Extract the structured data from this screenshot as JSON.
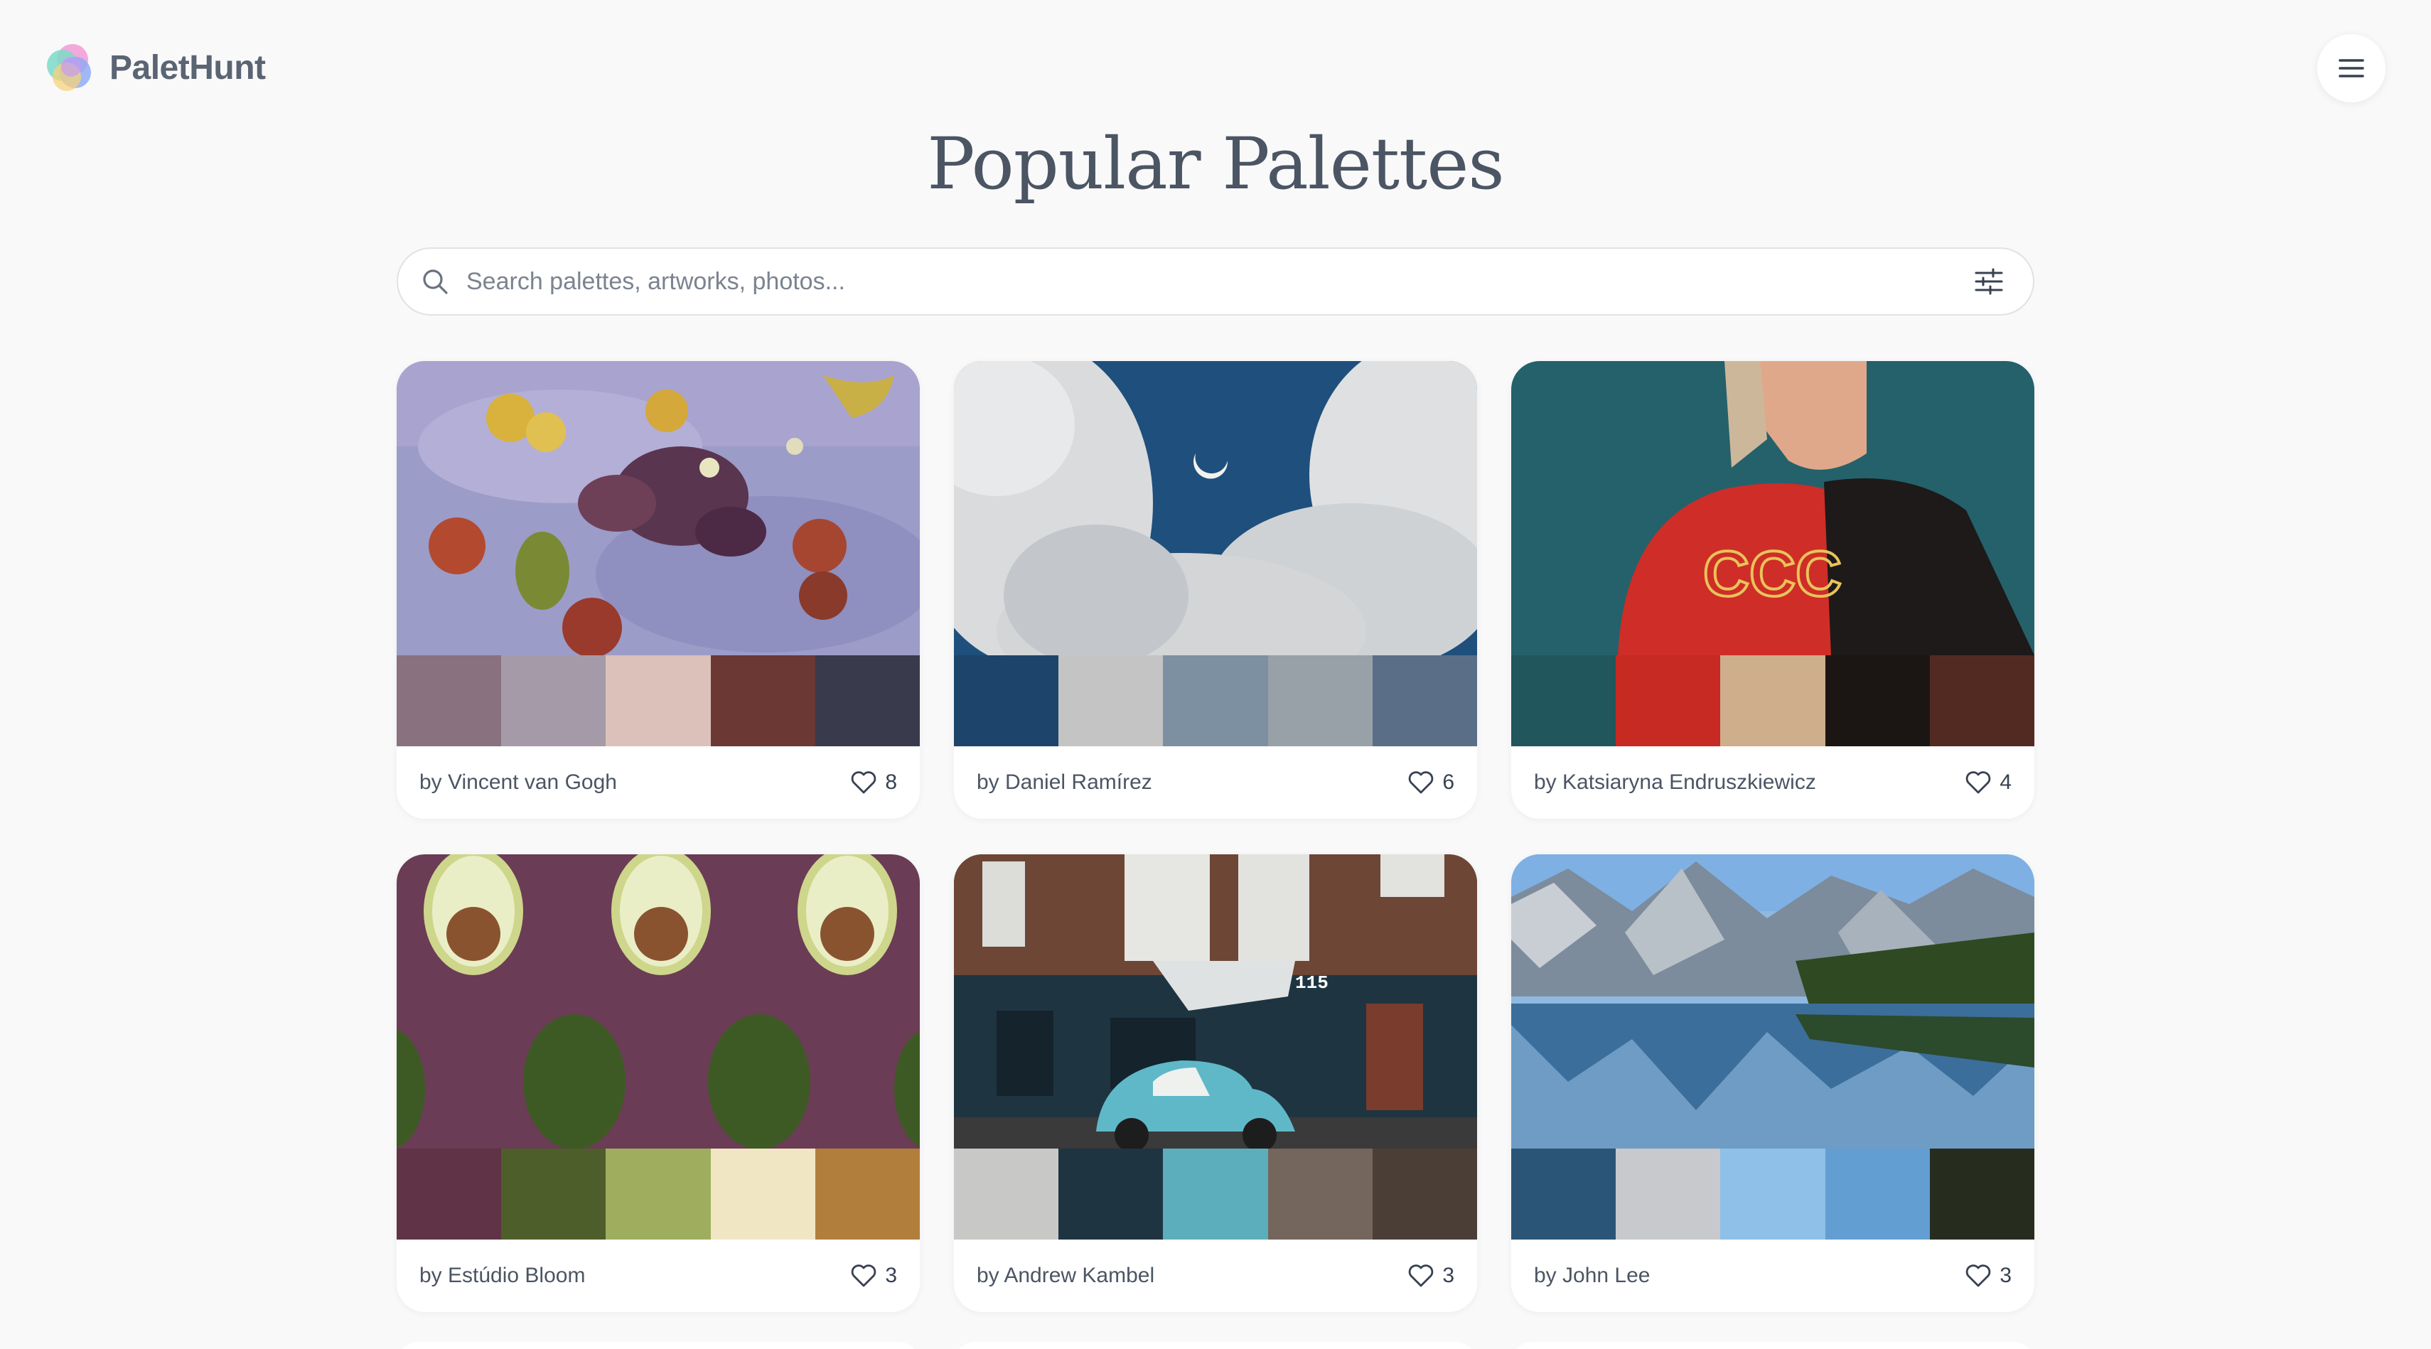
{
  "brand": {
    "name": "PaletHunt"
  },
  "page": {
    "title": "Popular Palettes"
  },
  "search": {
    "placeholder": "Search palettes, artworks, photos..."
  },
  "palettes": [
    {
      "author": "by Vincent van Gogh",
      "likes": "8",
      "image": "still-life-painting",
      "swatches": [
        "#8a7180",
        "#a59ba8",
        "#dbc1b9",
        "#6c3834",
        "#393a4c"
      ]
    },
    {
      "author": "by Daniel Ramírez",
      "likes": "6",
      "image": "clouds-moon-photo",
      "swatches": [
        "#1d446a",
        "#c4c4c4",
        "#7d90a2",
        "#98a0a8",
        "#5a6f87"
      ]
    },
    {
      "author": "by Katsiaryna Endruszkiewicz",
      "likes": "4",
      "image": "red-shirt-portrait-photo",
      "swatches": [
        "#21565d",
        "#c72923",
        "#cfae8c",
        "#1b1614",
        "#532a22"
      ]
    },
    {
      "author": "by Estúdio Bloom",
      "likes": "3",
      "image": "avocados-photo",
      "swatches": [
        "#603346",
        "#4e5e2b",
        "#9fae5e",
        "#f1e6c3",
        "#b17f3b"
      ]
    },
    {
      "author": "by Andrew Kambel",
      "likes": "3",
      "image": "beetle-car-street-photo",
      "swatches": [
        "#c8c9c7",
        "#1f3441",
        "#5daebd",
        "#74665c",
        "#4a3e36"
      ]
    },
    {
      "author": "by John Lee",
      "likes": "3",
      "image": "mountain-lake-photo",
      "swatches": [
        "#2b5577",
        "#c8c9cd",
        "#8ec0e8",
        "#639ed3",
        "#272d1e"
      ]
    }
  ]
}
